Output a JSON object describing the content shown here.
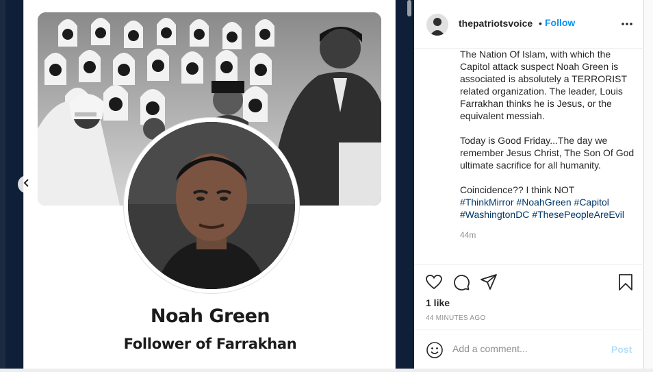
{
  "post": {
    "username": "thepatriotsvoice",
    "follow_separator": "•",
    "follow_label": "Follow",
    "caption_paragraphs": [
      "The Nation Of Islam, with which the Capitol attack suspect Noah Green is associated is absolutely a TERRORIST related organization. The leader, Louis Farrakhan thinks he is Jesus, or the equivalent messiah.",
      "Today is Good Friday...The day we remember Jesus Christ, The Son Of God ultimate sacrifice for all humanity."
    ],
    "caption_last_line": "Coincidence?? I think NOT",
    "hashtags": [
      "#ThinkMirror",
      "#NoahGreen",
      "#Capitol",
      "#WashingtonDC",
      "#ThesePeopleAreEvil"
    ],
    "caption_age": "44m",
    "likes_text": "1 like",
    "timestamp": "44 MINUTES AGO"
  },
  "media": {
    "name": "Noah Green",
    "subtitle": "Follower of Farrakhan"
  },
  "comment": {
    "placeholder": "Add a comment...",
    "post_label": "Post"
  },
  "icons": {
    "like": "heart-icon",
    "comment": "comment-bubble-icon",
    "share": "paper-plane-icon",
    "save": "bookmark-icon",
    "more": "more-horizontal-icon",
    "emoji": "smiley-icon",
    "prev": "chevron-left-icon"
  },
  "colors": {
    "accent": "#0095f6",
    "hashtag": "#00376b",
    "muted": "#8e8e8e",
    "post_disabled": "#b2dffc",
    "media_background": "#0f1f38"
  }
}
